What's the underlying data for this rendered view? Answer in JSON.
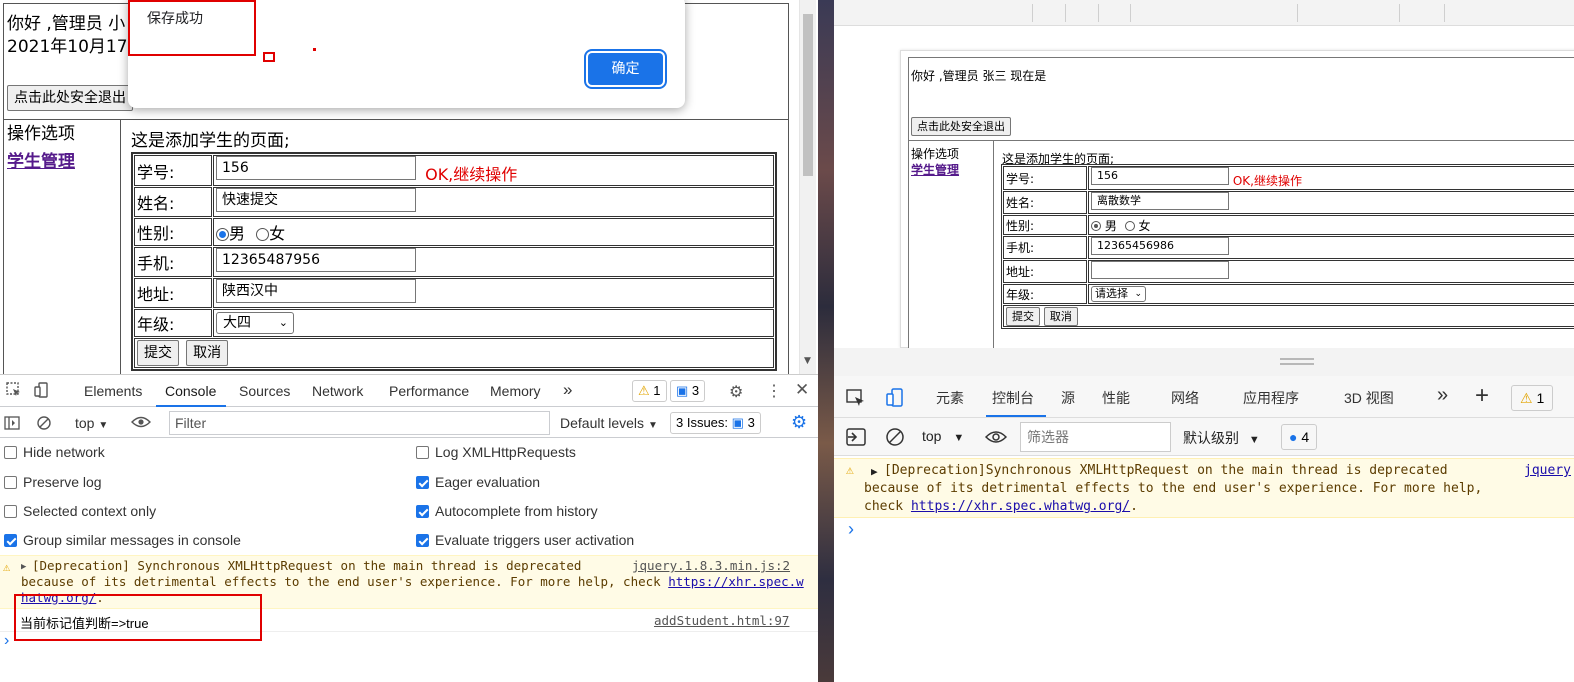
{
  "left": {
    "page": {
      "greeting": "你好 ,管理员 小",
      "date_partial": "2021年10月17",
      "logout_button": "点击此处安全退出",
      "ops_heading": "操作选项",
      "student_mgmt_link": "学生管理",
      "page_desc": "这是添加学生的页面;",
      "form": {
        "id_label": "学号:",
        "id_value": "156",
        "ok_msg": "OK,继续操作",
        "name_label": "姓名:",
        "name_value": "快速提交",
        "gender_label": "性别:",
        "male": "男",
        "female": "女",
        "gender_selected": "male",
        "phone_label": "手机:",
        "phone_value": "12365487956",
        "address_label": "地址:",
        "address_value": "陕西汉中",
        "grade_label": "年级:",
        "grade_value": "大四",
        "submit": "提交",
        "cancel": "取消"
      }
    },
    "dialog": {
      "message": "保存成功",
      "ok_button": "确定"
    },
    "devtools": {
      "tabs": [
        "Elements",
        "Console",
        "Sources",
        "Network",
        "Performance",
        "Memory"
      ],
      "active_tab": "Console",
      "more_tabs": "»",
      "warn_count": "1",
      "msg_count": "3",
      "context": "top",
      "filter_placeholder": "Filter",
      "levels": "Default levels",
      "issues_label": "3 Issues:",
      "issues_count": "3",
      "settings_left": [
        "Hide network",
        "Preserve log",
        "Selected context only",
        "Group similar messages in console"
      ],
      "settings_left_checked": [
        false,
        false,
        false,
        true
      ],
      "settings_right": [
        "Log XMLHttpRequests",
        "Eager evaluation",
        "Autocomplete from history",
        "Evaluate triggers user activation"
      ],
      "settings_right_checked": [
        false,
        true,
        true,
        true
      ],
      "warning": {
        "line1": "[Deprecation] Synchronous XMLHttpRequest on the main thread is deprecated",
        "line2": "because of its detrimental effects to the end user's experience. For more help, check",
        "link_a": "https://xhr.spec.w",
        "link_b": "hatwg.org/",
        "link_b_tail": ".",
        "source": "jquery.1.8.3.min.js:2"
      },
      "log": {
        "text": "当前标记值判断=>true",
        "source": "addStudent.html:97"
      },
      "prompt": "›"
    }
  },
  "right": {
    "page": {
      "greeting": "你好 ,管理员 张三 现在是",
      "logout_button": "点击此处安全退出",
      "ops_heading": "操作选项",
      "student_mgmt_link": "学生管理",
      "page_desc": "这是添加学生的页面;",
      "form": {
        "id_label": "学号:",
        "id_value": "156",
        "ok_msg": "OK,继续操作",
        "name_label": "姓名:",
        "name_value": "离散数学",
        "gender_label": "性别:",
        "male": "男",
        "female": "女",
        "phone_label": "手机:",
        "phone_value": "12365456986",
        "address_label": "地址:",
        "address_value": "",
        "grade_label": "年级:",
        "grade_value": "请选择",
        "submit": "提交",
        "cancel": "取消"
      }
    },
    "devtools": {
      "tabs": [
        "元素",
        "控制台",
        "源",
        "性能",
        "网络",
        "应用程序",
        "3D 视图"
      ],
      "active_tab": "控制台",
      "more": "»",
      "add": "+",
      "warn_count": "1",
      "context": "top",
      "filter_placeholder": "筛选器",
      "levels": "默认级别",
      "msg_count": "4",
      "warning": {
        "line1": "[Deprecation]Synchronous XMLHttpRequest on the main thread is deprecated",
        "line2": "because of its detrimental effects to the end user's experience. For more help,",
        "line3_prefix": "check ",
        "link": "https://xhr.spec.whatwg.org/",
        "line3_suffix": ".",
        "source": "jquery"
      },
      "prompt": "›"
    }
  },
  "colors": {
    "accent": "#1a73e8",
    "error_red": "#e00000",
    "warning_bg": "#fffbe6",
    "link_purple": "#551a8b"
  }
}
